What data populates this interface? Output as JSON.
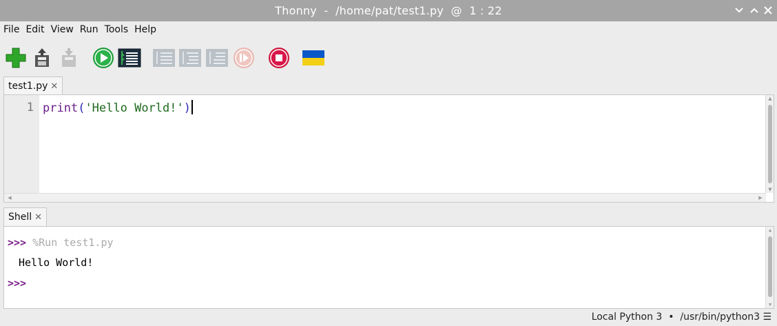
{
  "window": {
    "title": "Thonny  -  /home/pat/test1.py  @  1 : 22"
  },
  "menu": [
    "File",
    "Edit",
    "View",
    "Run",
    "Tools",
    "Help"
  ],
  "toolbar": {
    "icons": [
      "new-file-icon",
      "open-file-icon",
      "save-file-icon",
      "run-icon",
      "debug-icon",
      "step-over-icon",
      "step-into-icon",
      "step-out-icon",
      "resume-icon",
      "stop-icon",
      "ukraine-flag-icon"
    ],
    "colors": {
      "run": "#1e9e3a",
      "stop": "#d0143c",
      "new": "#2ea62a",
      "flag_blue": "#0a57c8",
      "flag_yellow": "#f3cf15"
    }
  },
  "editor": {
    "tab_label": "test1.py",
    "line_number": "1",
    "code": {
      "fn": "print",
      "open": "(",
      "string": "'Hello World!'",
      "close": ")"
    }
  },
  "shell": {
    "tab_label": "Shell",
    "prompt": ">>>",
    "command": "%Run test1.py",
    "output": "Hello World!"
  },
  "status": {
    "text": "Local Python 3  •  /usr/bin/python3"
  }
}
